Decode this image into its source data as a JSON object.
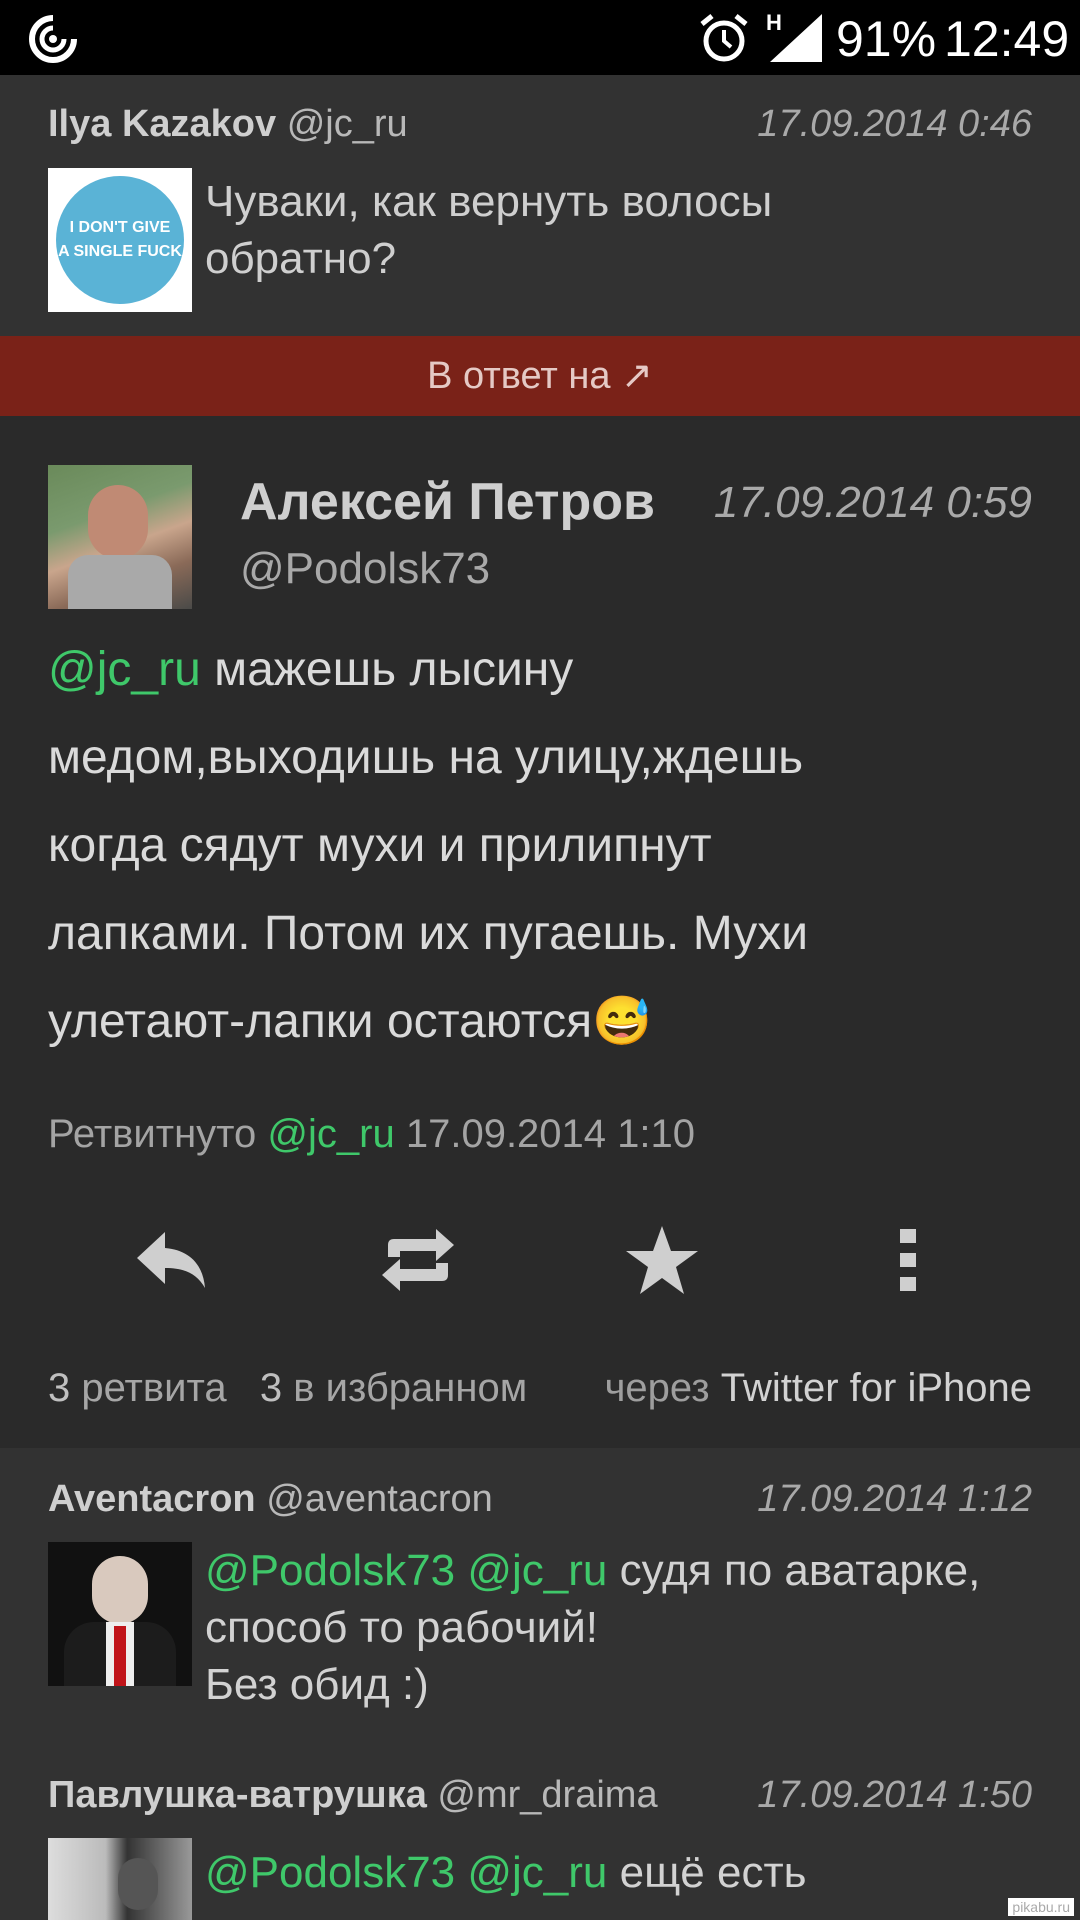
{
  "status": {
    "network": "H",
    "battery": "91%",
    "time": "12:49"
  },
  "parent_tweet": {
    "name": "Ilya Kazakov",
    "handle": "@jc_ru",
    "date": "17.09.2014 0:46",
    "avatar_text": [
      "I DON'T GIVE",
      "A SINGLE FUCK"
    ],
    "text_lines": [
      "Чуваки, как вернуть волосы",
      "обратно?"
    ]
  },
  "reply_bar": {
    "label": "В ответ на ↗"
  },
  "main_tweet": {
    "name": "Алексей Петров",
    "handle": "@Podolsk73",
    "date": "17.09.2014 0:59",
    "mention": "@jc_ru",
    "line1": " мажешь лысину",
    "lines": [
      "медом,выходишь на улицу,ждешь",
      "когда сядут мухи и прилипнут",
      "лапками. Потом их пугаешь. Мухи",
      "улетают-лапки остаются"
    ],
    "emoji": "😅",
    "retweeted_label": "Ретвитнуто",
    "retweeted_by": "@jc_ru",
    "retweeted_date": "17.09.2014 1:10",
    "retweets_count": "3",
    "retweets_label": "ретвита",
    "favorites_count": "3",
    "favorites_label": "в избранном",
    "via_label": "через",
    "via_source": "Twitter for iPhone"
  },
  "replies": [
    {
      "name": "Aventacron",
      "handle": "@aventacron",
      "date": "17.09.2014 1:12",
      "mentions": "@Podolsk73 @jc_ru",
      "line1": " судя по аватарке,",
      "line2": "способ то рабочий!",
      "line3": "Без обид :)"
    },
    {
      "name": "Павлушка-ватрушка",
      "handle": "@mr_draima",
      "date": "17.09.2014 1:50",
      "mentions": "@Podolsk73 @jc_ru",
      "line1": " ещё есть"
    }
  ],
  "watermark": "pikabu.ru",
  "colors": {
    "mention": "#3fc86a",
    "reply_bar": "#7a2218",
    "background": "#262626"
  }
}
